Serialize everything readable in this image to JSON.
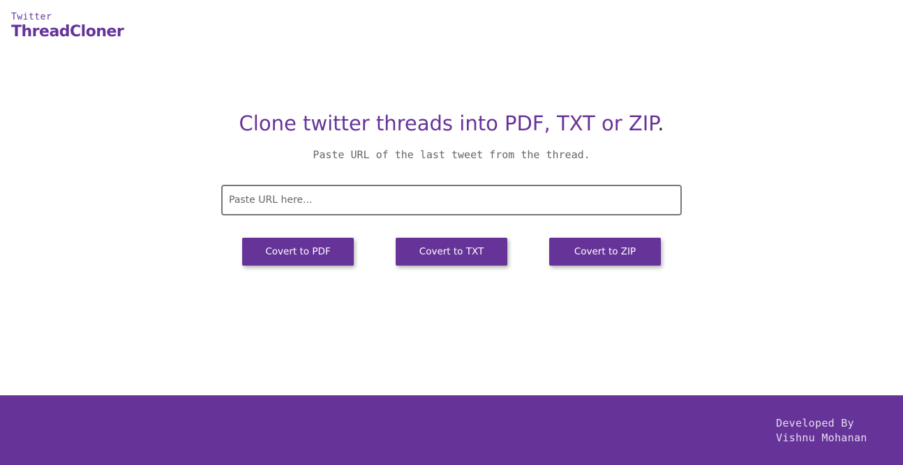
{
  "logo": {
    "small": "Twitter",
    "big": "ThreadCloner"
  },
  "hero": {
    "headline": "Clone twitter threads into PDF, TXT or ZIP",
    "headline_dot": ".",
    "subtitle": "Paste URL of the last tweet from the thread."
  },
  "url_input": {
    "placeholder": "Paste URL here...",
    "value": ""
  },
  "buttons": {
    "pdf": "Covert to PDF",
    "txt": "Covert to TXT",
    "zip": "Covert to ZIP"
  },
  "footer": {
    "line1": "Developed By",
    "line2": "Vishnu Mohanan"
  },
  "colors": {
    "brand": "#663399",
    "footer_text": "#e6ddf0",
    "subtitle": "#666666"
  }
}
